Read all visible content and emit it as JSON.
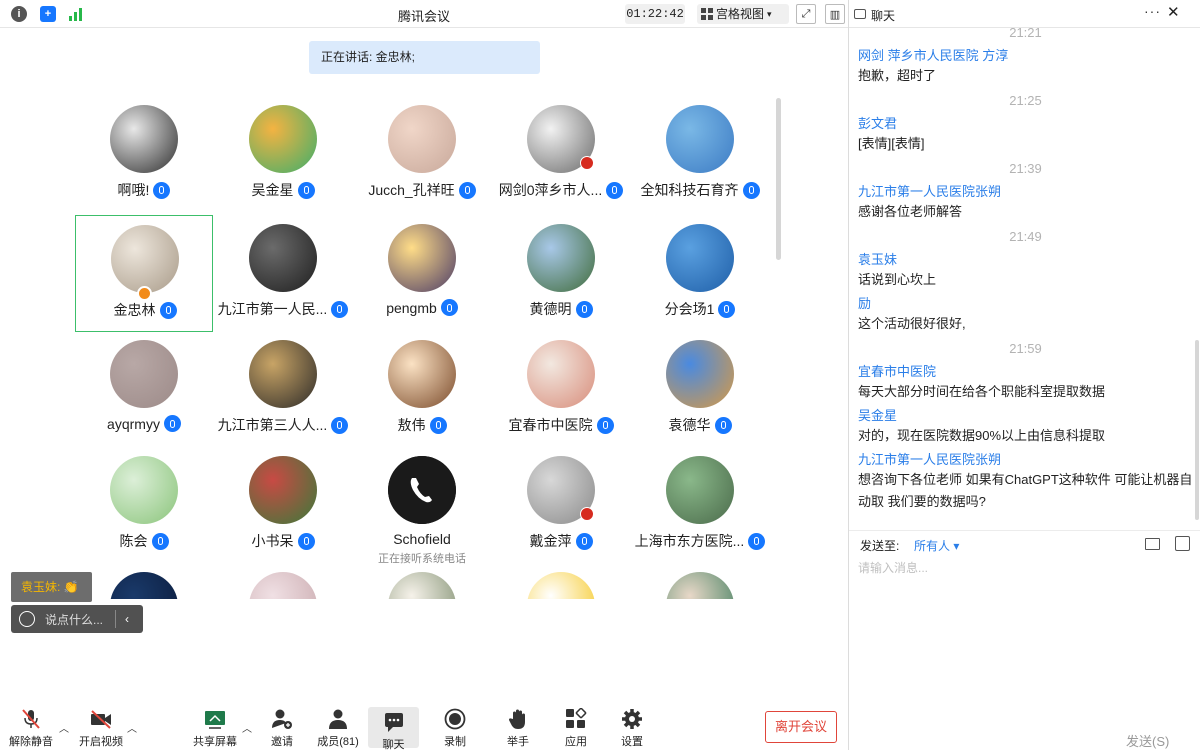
{
  "titlebar": {
    "title": "腾讯会议",
    "timer": "01:22:42",
    "view_label": "宫格视图",
    "icons": [
      "info-icon",
      "shield-icon",
      "signal-icon"
    ]
  },
  "speaking": "正在讲话: 金忠林;",
  "participants": [
    {
      "name": "啊哦!",
      "avatar_colors": [
        "#e8e8e8",
        "#2d2d2d"
      ]
    },
    {
      "name": "吴金星",
      "avatar_colors": [
        "#f4b342",
        "#3cae6b"
      ]
    },
    {
      "name": "Jucch_孔祥旺",
      "avatar_colors": [
        "#f0d6c8",
        "#c8a89a"
      ]
    },
    {
      "name": "网剑0萍乡市人...",
      "avatar_colors": [
        "#f2f2f2",
        "#6a6a6a"
      ]
    },
    {
      "name": "全知科技石育齐",
      "avatar_colors": [
        "#7ab8e6",
        "#3c7bc4"
      ]
    },
    {
      "name": "金忠林",
      "avatar_colors": [
        "#ede6dc",
        "#a89a88"
      ]
    },
    {
      "name": "九江市第一人民...",
      "avatar_colors": [
        "#6b6b6b",
        "#1e1e1e"
      ]
    },
    {
      "name": "pengmb",
      "avatar_colors": [
        "#ffdd88",
        "#4a3a66"
      ]
    },
    {
      "name": "黄德明",
      "avatar_colors": [
        "#a8c8e8",
        "#3f6b3a"
      ]
    },
    {
      "name": "分会场1",
      "avatar_colors": [
        "#5aa0e0",
        "#1f5fa8"
      ]
    },
    {
      "name": "ayqrmyy",
      "avatar_colors": [
        "#b8a8a6",
        "#9c8a88"
      ]
    },
    {
      "name": "九江市第三人人...",
      "avatar_colors": [
        "#c8a466",
        "#2c2a28"
      ]
    },
    {
      "name": "敖伟",
      "avatar_colors": [
        "#fbe2c4",
        "#7a4a2a"
      ]
    },
    {
      "name": "宜春市中医院",
      "avatar_colors": [
        "#f2e8e0",
        "#d88c7a"
      ]
    },
    {
      "name": "袁德华",
      "avatar_colors": [
        "#4a8ae0",
        "#d89a44"
      ]
    },
    {
      "name": "陈会",
      "avatar_colors": [
        "#dcefd8",
        "#8ac47a"
      ]
    },
    {
      "name": "小书呆",
      "avatar_colors": [
        "#c84a44",
        "#3a7a3a"
      ]
    },
    {
      "name": "Schofield",
      "avatar_colors": [
        "#1a1a1a",
        "#000000"
      ],
      "status": "正在接听系统电话",
      "no_mic": true
    },
    {
      "name": "戴金萍",
      "avatar_colors": [
        "#d8d8d8",
        "#8a8a8a"
      ]
    },
    {
      "name": "上海市东方医院...",
      "avatar_colors": [
        "#8ab88a",
        "#4a6a4a"
      ]
    },
    {
      "name": "",
      "avatar_colors": [
        "#1a3a6a",
        "#0a1a3a"
      ]
    },
    {
      "name": "",
      "avatar_colors": [
        "#f0e0e4",
        "#c8a8ac"
      ]
    },
    {
      "name": "",
      "avatar_colors": [
        "#f6f2ea",
        "#7a8a6a"
      ]
    },
    {
      "name": "",
      "avatar_colors": [
        "#ffffff",
        "#f5c518"
      ]
    },
    {
      "name": "",
      "avatar_colors": [
        "#e8d8c8",
        "#3a7a5a"
      ]
    }
  ],
  "floating_message": "袁玉妹: 👏",
  "say_placeholder": "说点什么...",
  "toolbar": {
    "unmute": "解除静音",
    "video": "开启视频",
    "share": "共享屏幕",
    "invite": "邀请",
    "members": "成员(81)",
    "chat": "聊天",
    "record": "录制",
    "raise_hand": "举手",
    "apps": "应用",
    "settings": "设置",
    "leave": "离开会议"
  },
  "chat": {
    "title": "聊天",
    "messages": [
      {
        "type": "time",
        "text": "21:21"
      },
      {
        "type": "sender",
        "text": "网剑    萍乡市人民医院 方淳"
      },
      {
        "type": "text",
        "text": "抱歉，超时了"
      },
      {
        "type": "time",
        "text": "21:25"
      },
      {
        "type": "sender",
        "text": "彭文君"
      },
      {
        "type": "text",
        "text": "[表情][表情]"
      },
      {
        "type": "time",
        "text": "21:39"
      },
      {
        "type": "sender",
        "text": "九江市第一人民医院张朔"
      },
      {
        "type": "text",
        "text": "感谢各位老师解答"
      },
      {
        "type": "time",
        "text": "21:49"
      },
      {
        "type": "sender",
        "text": "袁玉妹"
      },
      {
        "type": "text",
        "text": "话说到心坎上"
      },
      {
        "type": "sender",
        "text": "励"
      },
      {
        "type": "text",
        "text": "这个活动很好很好,"
      },
      {
        "type": "time",
        "text": "21:59"
      },
      {
        "type": "sender",
        "text": "宜春市中医院"
      },
      {
        "type": "text",
        "text": "每天大部分时间在给各个职能科室提取数据"
      },
      {
        "type": "sender",
        "text": "吴金星"
      },
      {
        "type": "text",
        "text": "对的，现在医院数据90%以上由信息科提取"
      },
      {
        "type": "sender",
        "text": "九江市第一人民医院张朔"
      },
      {
        "type": "text",
        "text": "想咨询下各位老师 如果有ChatGPT这种软件 可能让机器自动取 我们要的数据吗?"
      }
    ],
    "send_to_label": "发送至:",
    "send_to_target": "所有人 ▾",
    "input_placeholder": "请输入消息...",
    "send_button": "发送(S)"
  }
}
